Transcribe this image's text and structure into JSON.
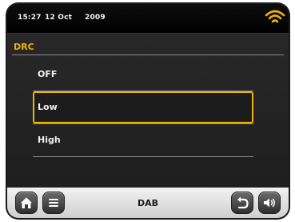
{
  "status": {
    "time": "15:27",
    "date": "12 Oct",
    "year": "2009",
    "wifi_icon": "wifi-signal-icon",
    "accent": "#f0b400"
  },
  "section": {
    "title": "DRC"
  },
  "menu": {
    "items": [
      {
        "label": "OFF",
        "selected": false
      },
      {
        "label": "Low",
        "selected": true
      },
      {
        "label": "High",
        "selected": false
      }
    ]
  },
  "bottombar": {
    "source": "DAB",
    "buttons": {
      "home": "home-icon",
      "menu": "menu-icon",
      "back": "back-icon",
      "volume": "volume-icon"
    }
  }
}
